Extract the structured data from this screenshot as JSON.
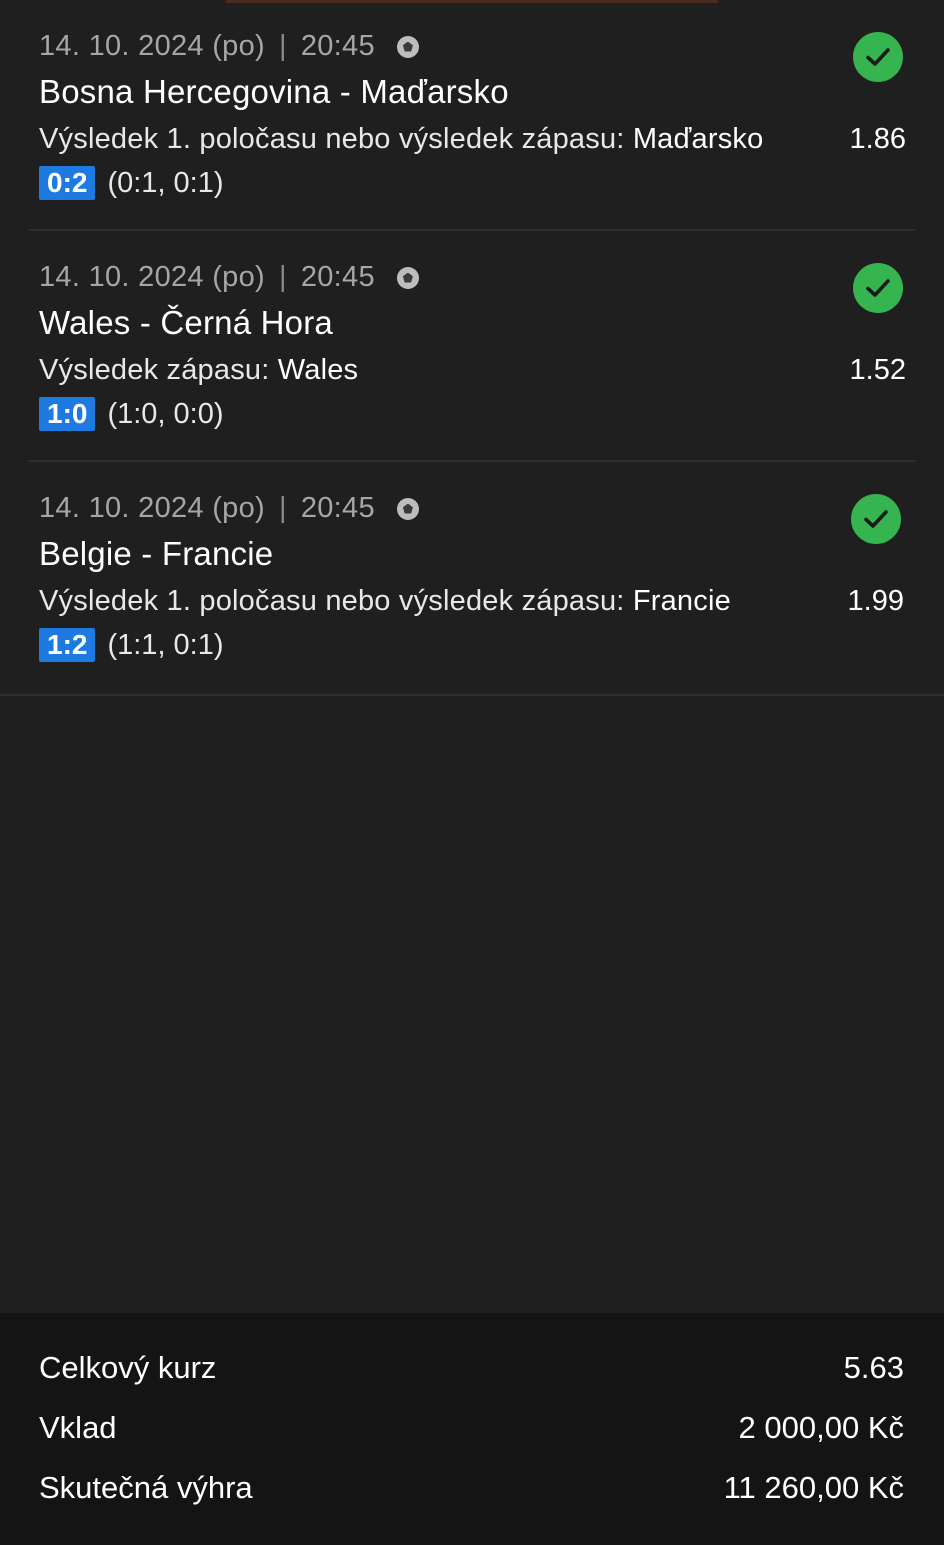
{
  "bets": [
    {
      "date": "14. 10. 2024 (po)",
      "time": "20:45",
      "sport_icon": "soccer-ball-icon",
      "teams": "Bosna Hercegovina - Maďarsko",
      "market": "Výsledek 1. poločasu nebo výsledek zápasu:",
      "pick": "Maďarsko",
      "odds": "1.86",
      "score": "0:2",
      "halves": "(0:1, 0:1)",
      "status_icon": "check-circle-icon"
    },
    {
      "date": "14. 10. 2024 (po)",
      "time": "20:45",
      "sport_icon": "soccer-ball-icon",
      "teams": "Wales - Černá Hora",
      "market": "Výsledek zápasu:",
      "pick": "Wales",
      "odds": "1.52",
      "score": "1:0",
      "halves": "(1:0, 0:0)",
      "status_icon": "check-circle-icon"
    },
    {
      "date": "14. 10. 2024 (po)",
      "time": "20:45",
      "sport_icon": "soccer-ball-icon",
      "teams": "Belgie - Francie",
      "market": "Výsledek 1. poločasu nebo výsledek zápasu:",
      "pick": "Francie",
      "odds": "1.99",
      "score": "1:2",
      "halves": "(1:1, 0:1)",
      "status_icon": "check-circle-icon"
    }
  ],
  "summary": {
    "total_odds_label": "Celkový kurz",
    "total_odds_value": "5.63",
    "stake_label": "Vklad",
    "stake_value": "2 000,00 Kč",
    "win_label": "Skutečná výhra",
    "win_value": "11 260,00 Kč"
  },
  "colors": {
    "background": "#1f1f1f",
    "summary_background": "#141414",
    "score_badge": "#1e7ae0",
    "win_check": "#35b44f"
  }
}
